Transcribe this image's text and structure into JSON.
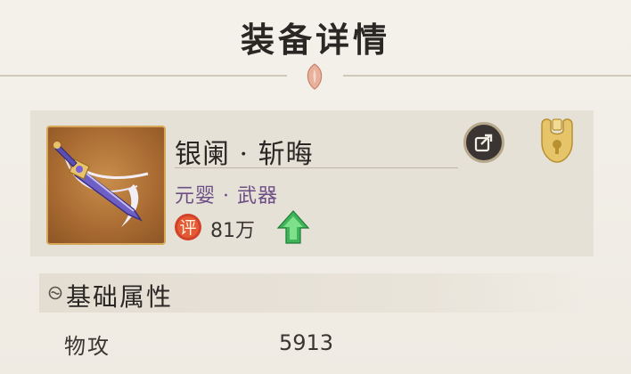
{
  "header": {
    "title": "装备详情"
  },
  "equipment": {
    "name": "银阑 · 斩晦",
    "type": "元婴 · 武器",
    "score_badge": "评",
    "score": "81万",
    "icon": "sword-item-icon"
  },
  "actions": {
    "share_icon": "share-icon",
    "lock_icon": "lock-icon"
  },
  "section": {
    "title": "基础属性"
  },
  "attributes": [
    {
      "label": "物攻",
      "value": "5913"
    }
  ],
  "colors": {
    "background": "#f2efe8",
    "card": "#e6e1d7",
    "item_type": "#6d4f86",
    "frame_gold": "#d7a85a",
    "badge_red": "#d2412a",
    "arrow_green": "#3fb45a"
  }
}
